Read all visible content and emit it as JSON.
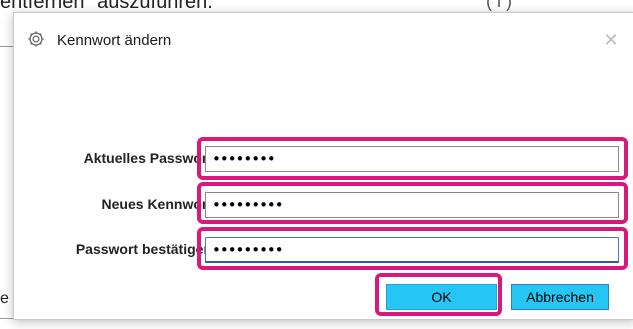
{
  "background": {
    "top_text": "entfernen\" auszuführen.",
    "top_glyph": "( i )",
    "left_text": "e"
  },
  "dialog": {
    "title": "Kennwort ändern",
    "icon": "gear-icon",
    "close_label": "✕"
  },
  "fields": [
    {
      "label": "Aktuelles Passwort",
      "value": "••••••••"
    },
    {
      "label": "Neues Kennwort",
      "value": "•••••••••"
    },
    {
      "label": "Passwort bestätigen",
      "value": "•••••••••"
    }
  ],
  "buttons": {
    "ok_label": "OK",
    "cancel_label": "Abbrechen"
  },
  "colors": {
    "highlight": "#d6197a",
    "button_bg": "#26c6f4"
  }
}
